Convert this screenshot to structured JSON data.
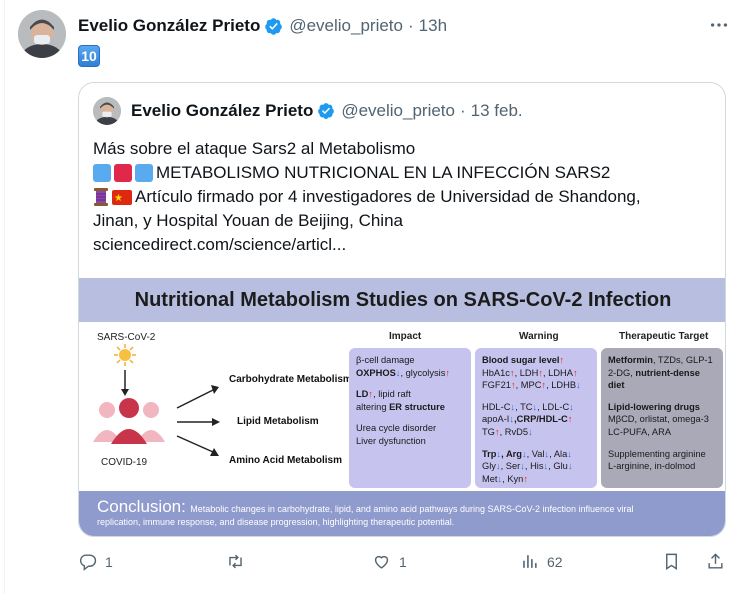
{
  "tweet": {
    "author_name": "Evelio González Prieto",
    "handle": "@evelio_prieto",
    "separator": "·",
    "time": "13h",
    "body_emoji": "10"
  },
  "quote": {
    "author_name": "Evelio González Prieto",
    "handle": "@evelio_prieto",
    "separator": "·",
    "time": "13 feb.",
    "line1": "Más sobre el ataque Sars2 al Metabolismo",
    "line2": "METABOLISMO NUTRICIONAL EN LA INFECCIÓN SARS2",
    "line3": "Artículo firmado por 4 investigadores de Universidad de Shandong,",
    "line4": "Jinan, y Hospital Youan de Beijing, China",
    "line5": "sciencedirect.com/science/articl..."
  },
  "infographic": {
    "title": "Nutritional Metabolism Studies on SARS-CoV-2 Infection",
    "virus_label": "SARS-CoV-2",
    "disease_label": "COVID-19",
    "col_impact": "Impact",
    "col_warning": "Warning",
    "col_target": "Therapeutic Target",
    "metab_carb": "Carbohydrate Metabolism",
    "metab_lipid": "Lipid Metabolism",
    "metab_amino": "Amino Acid Metabolism",
    "impact_1": "β-cell damage",
    "impact_2a": "OXPHOS",
    "impact_2b": ", glycolysis",
    "impact_3a": "LD",
    "impact_3b": ", lipid raft",
    "impact_4a": "altering ",
    "impact_4b": "ER structure",
    "impact_5": "Urea cycle disorder",
    "impact_6": "Liver dysfunction",
    "warn_1": "Blood sugar level",
    "warn_2a": "HbA1c",
    "warn_2b": ", LDH",
    "warn_2c": ", LDHA",
    "warn_3a": "FGF21",
    "warn_3b": ", MPC",
    "warn_3c": ", LDHB",
    "warn_4a": "HDL-C",
    "warn_4b": ", TC",
    "warn_4c": ", LDL-C",
    "warn_5a": "apoA-I",
    "warn_5b": ",CRP/HDL-C",
    "warn_6a": "TG",
    "warn_6b": ", RvD5",
    "warn_7a": "Trp",
    "warn_7b": ", Arg",
    "warn_7c": ", Val",
    "warn_7d": ", Ala",
    "warn_8a": "Gly",
    "warn_8b": ", Ser",
    "warn_8c": ", His",
    "warn_8d": ", Glu",
    "warn_9a": "Met",
    "warn_9b": ", Kyn",
    "up_arrow": "↑",
    "down_arrow": "↓",
    "target_1a": "Metformin",
    "target_1b": ", TZDs, GLP-1",
    "target_2a": "2-DG, ",
    "target_2b": "nutrient-dense diet",
    "target_3": "Lipid-lowering drugs",
    "target_4": "MβCD, orlistat, omega-3",
    "target_5": "LC-PUFA, ARA",
    "target_6": "Supplementing arginine",
    "target_7": "L-arginine, in-dolmod",
    "conclusion_head": "Conclusion:",
    "conclusion_text1": "Metabolic changes in carbohydrate, lipid, and amino acid pathways during SARS-CoV-2 infection influence viral",
    "conclusion_text2": "replication, immune response, and disease progression, highlighting therapeutic potential."
  },
  "actions": {
    "reply_count": "1",
    "retweet_count": "",
    "like_count": "1",
    "views_count": "62"
  },
  "colors": {
    "verified_blue": "#1d9bf0",
    "muted": "#536471",
    "box_purple": "#c6c3ee",
    "box_gray": "#a9a9b8",
    "title_bar": "#b7bee0"
  },
  "icons": [
    "verified-badge-icon",
    "more-icon",
    "reply-icon",
    "retweet-icon",
    "like-icon",
    "views-icon",
    "bookmark-icon",
    "share-icon"
  ]
}
